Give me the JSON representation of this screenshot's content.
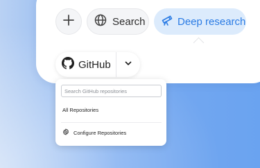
{
  "toolbar": {
    "search_label": "Search",
    "deep_research_label": "Deep research"
  },
  "github": {
    "label": "GitHub"
  },
  "dropdown": {
    "search_placeholder": "Search GitHub repositories",
    "all_repositories": "All Repositories",
    "configure_repositories": "Configure Repositories"
  },
  "colors": {
    "accent": "#2a7be4",
    "accent_bg": "#dcebfc",
    "background_gradient_start": "#b9d1f3",
    "background_gradient_end": "#6aa3f0"
  },
  "icons": [
    "plus-icon",
    "globe-icon",
    "telescope-icon",
    "github-icon",
    "chevron-down-icon",
    "gear-icon"
  ]
}
